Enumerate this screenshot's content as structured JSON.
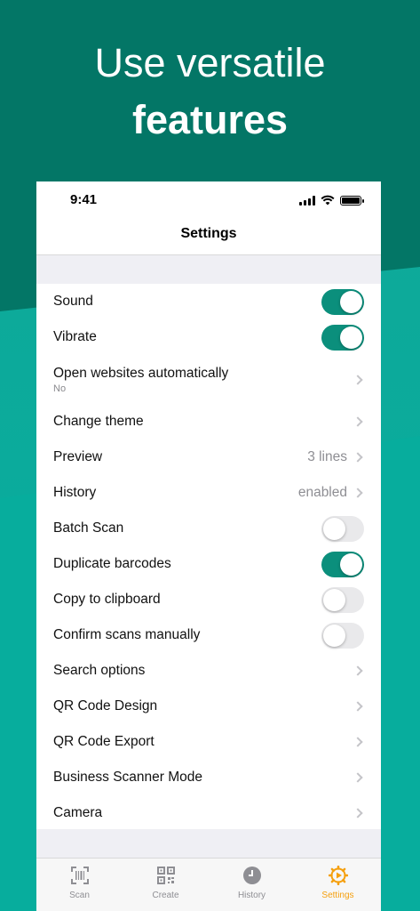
{
  "headline": {
    "line1": "Use versatile",
    "line2": "features"
  },
  "status": {
    "time": "9:41"
  },
  "nav": {
    "title": "Settings"
  },
  "settings": [
    {
      "label": "Sound",
      "type": "toggle",
      "on": true
    },
    {
      "label": "Vibrate",
      "type": "toggle",
      "on": true
    },
    {
      "label": "Open websites automatically",
      "sub": "No",
      "type": "link"
    },
    {
      "label": "Change theme",
      "type": "link"
    },
    {
      "label": "Preview",
      "value": "3 lines",
      "type": "link"
    },
    {
      "label": "History",
      "value": "enabled",
      "type": "link"
    },
    {
      "label": "Batch Scan",
      "type": "toggle",
      "on": false
    },
    {
      "label": "Duplicate barcodes",
      "type": "toggle",
      "on": true
    },
    {
      "label": "Copy to clipboard",
      "type": "toggle",
      "on": false
    },
    {
      "label": "Confirm scans manually",
      "type": "toggle",
      "on": false
    },
    {
      "label": "Search options",
      "type": "link"
    },
    {
      "label": "QR Code Design",
      "type": "link"
    },
    {
      "label": "QR Code Export",
      "type": "link"
    },
    {
      "label": "Business Scanner Mode",
      "type": "link"
    },
    {
      "label": "Camera",
      "type": "link"
    }
  ],
  "tabs": [
    {
      "label": "Scan",
      "icon": "scan-icon"
    },
    {
      "label": "Create",
      "icon": "qr-code-icon"
    },
    {
      "label": "History",
      "icon": "clock-icon"
    },
    {
      "label": "Settings",
      "icon": "gear-icon",
      "active": true
    }
  ],
  "colors": {
    "accent": "#0b8f7c",
    "active_tab": "#f5a00f",
    "background": "#037666"
  }
}
